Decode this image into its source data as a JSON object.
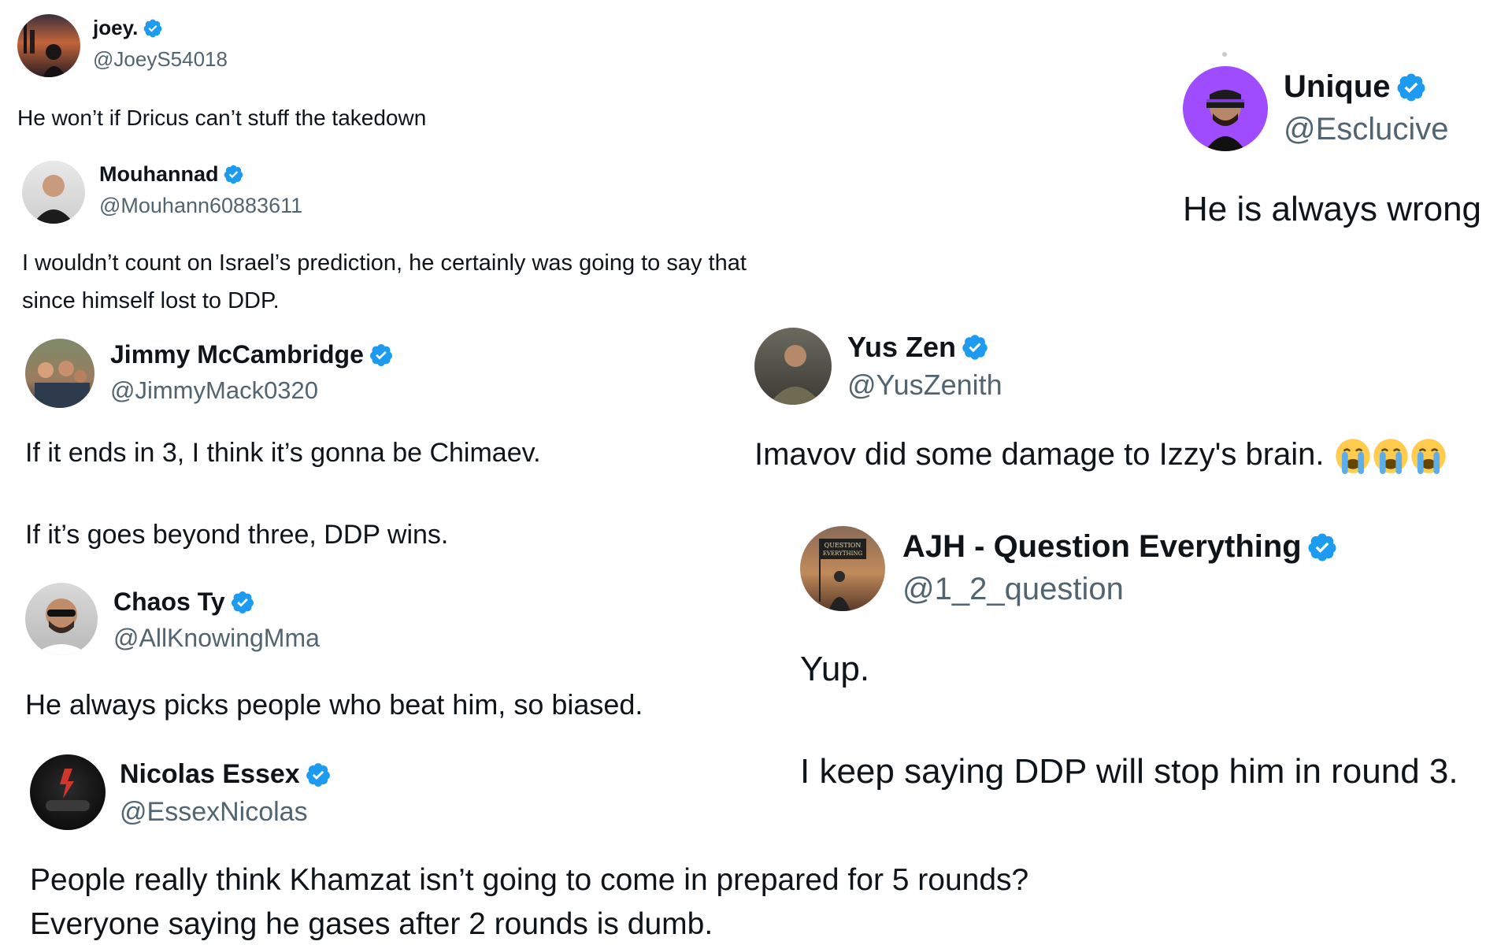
{
  "tweets": [
    {
      "name": "joey.",
      "handle": "@JoeyS54018",
      "text": [
        "He won’t if Dricus can’t stuff the takedown"
      ]
    },
    {
      "name": "Mouhannad",
      "handle": "@Mouhann60883611",
      "text": [
        "I wouldn’t count on Israel’s prediction, he certainly was going to say that",
        "since himself lost to DDP."
      ]
    },
    {
      "name": "Jimmy McCambridge",
      "handle": "@JimmyMack0320",
      "text": [
        "If it ends in 3, I think it’s gonna be Chimaev.",
        "If it’s goes beyond three, DDP wins."
      ]
    },
    {
      "name": "Chaos Ty",
      "handle": "@AllKnowingMma",
      "text": [
        "He always picks people who beat him, so biased."
      ]
    },
    {
      "name": "Nicolas Essex",
      "handle": "@EssexNicolas",
      "text": [
        "People really think Khamzat isn’t going to come in prepared for 5 rounds?",
        "Everyone saying he gases after 2 rounds is dumb."
      ]
    },
    {
      "name": "Unique",
      "handle": "@Esclucive",
      "text": [
        "He is always wrong"
      ]
    },
    {
      "name": "Yus Zen",
      "handle": "@YusZenith",
      "text": [
        "Imavov did some damage to Izzy's brain."
      ],
      "emoji": [
        "loudly-crying-face-icon",
        "loudly-crying-face-icon",
        "loudly-crying-face-icon"
      ]
    },
    {
      "name": "AJH - Question Everything",
      "handle": "@1_2_question",
      "text": [
        "Yup.",
        "I keep saying DDP will stop him in round 3."
      ],
      "avatar_text": [
        "QUESTION",
        "EVERYTHING"
      ]
    }
  ],
  "colors": {
    "verified": "#1d9bf0",
    "handle": "#536471",
    "text": "#0f1419"
  }
}
